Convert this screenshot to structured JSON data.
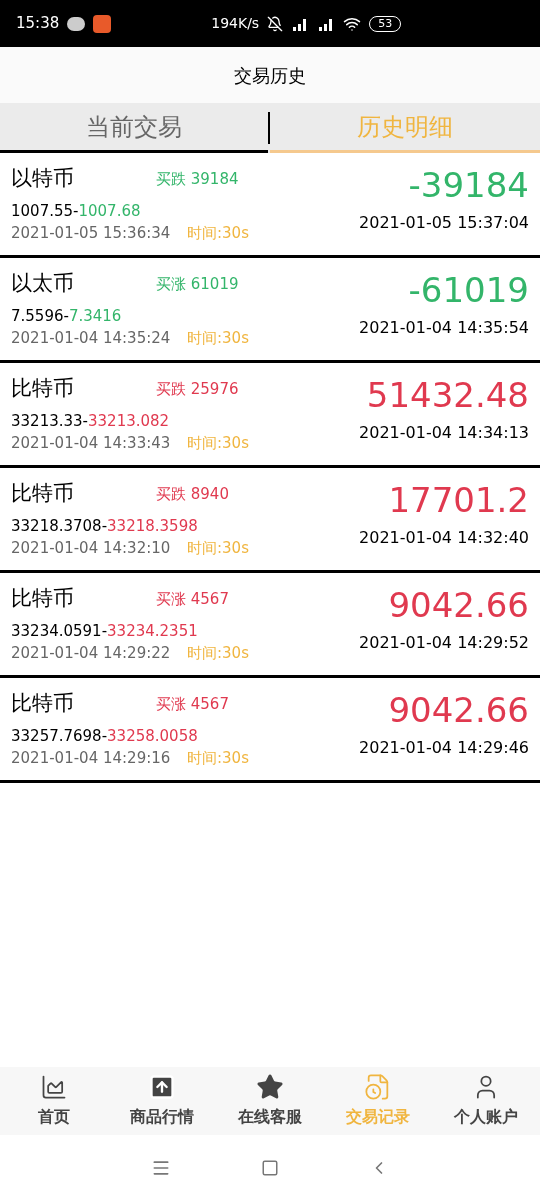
{
  "status_bar": {
    "time": "15:38",
    "speed": "194K/s",
    "battery": "53"
  },
  "title": "交易历史",
  "tabs": [
    {
      "label": "当前交易",
      "selected": false
    },
    {
      "label": "历史明细",
      "selected": true
    }
  ],
  "trades": [
    {
      "name": "以特币",
      "direction": "买跌 39184",
      "open_price": "1007.55-",
      "close_price": "1007.68",
      "open_time": "2021-01-05 15:36:34",
      "duration": "时间:30s",
      "amount": "-39184",
      "close_time": "2021-01-05 15:37:04",
      "color": "#33b56a"
    },
    {
      "name": "以太币",
      "direction": "买涨 61019",
      "open_price": "7.5596-",
      "close_price": "7.3416",
      "open_time": "2021-01-04 14:35:24",
      "duration": "时间:30s",
      "amount": "-61019",
      "close_time": "2021-01-04 14:35:54",
      "color": "#33b56a"
    },
    {
      "name": "比特币",
      "direction": "买跌 25976",
      "open_price": "33213.33-",
      "close_price": "33213.082",
      "open_time": "2021-01-04 14:33:43",
      "duration": "时间:30s",
      "amount": "51432.48",
      "close_time": "2021-01-04 14:34:13",
      "color": "#e0394f"
    },
    {
      "name": "比特币",
      "direction": "买跌 8940",
      "open_price": "33218.3708-",
      "close_price": "33218.3598",
      "open_time": "2021-01-04 14:32:10",
      "duration": "时间:30s",
      "amount": "17701.2",
      "close_time": "2021-01-04 14:32:40",
      "color": "#e0394f"
    },
    {
      "name": "比特币",
      "direction": "买涨 4567",
      "open_price": "33234.0591-",
      "close_price": "33234.2351",
      "open_time": "2021-01-04 14:29:22",
      "duration": "时间:30s",
      "amount": "9042.66",
      "close_time": "2021-01-04 14:29:52",
      "color": "#e0394f"
    },
    {
      "name": "比特币",
      "direction": "买涨 4567",
      "open_price": "33257.7698-",
      "close_price": "33258.0058",
      "open_time": "2021-01-04 14:29:16",
      "duration": "时间:30s",
      "amount": "9042.66",
      "close_time": "2021-01-04 14:29:46",
      "color": "#e0394f"
    }
  ],
  "bottom_nav": [
    {
      "label": "首页",
      "kind": "chart",
      "selected": false
    },
    {
      "label": "商品行情",
      "kind": "upload",
      "selected": false
    },
    {
      "label": "在线客服",
      "kind": "star",
      "selected": false
    },
    {
      "label": "交易记录",
      "kind": "record",
      "selected": true
    },
    {
      "label": "个人账户",
      "kind": "user",
      "selected": false
    }
  ]
}
